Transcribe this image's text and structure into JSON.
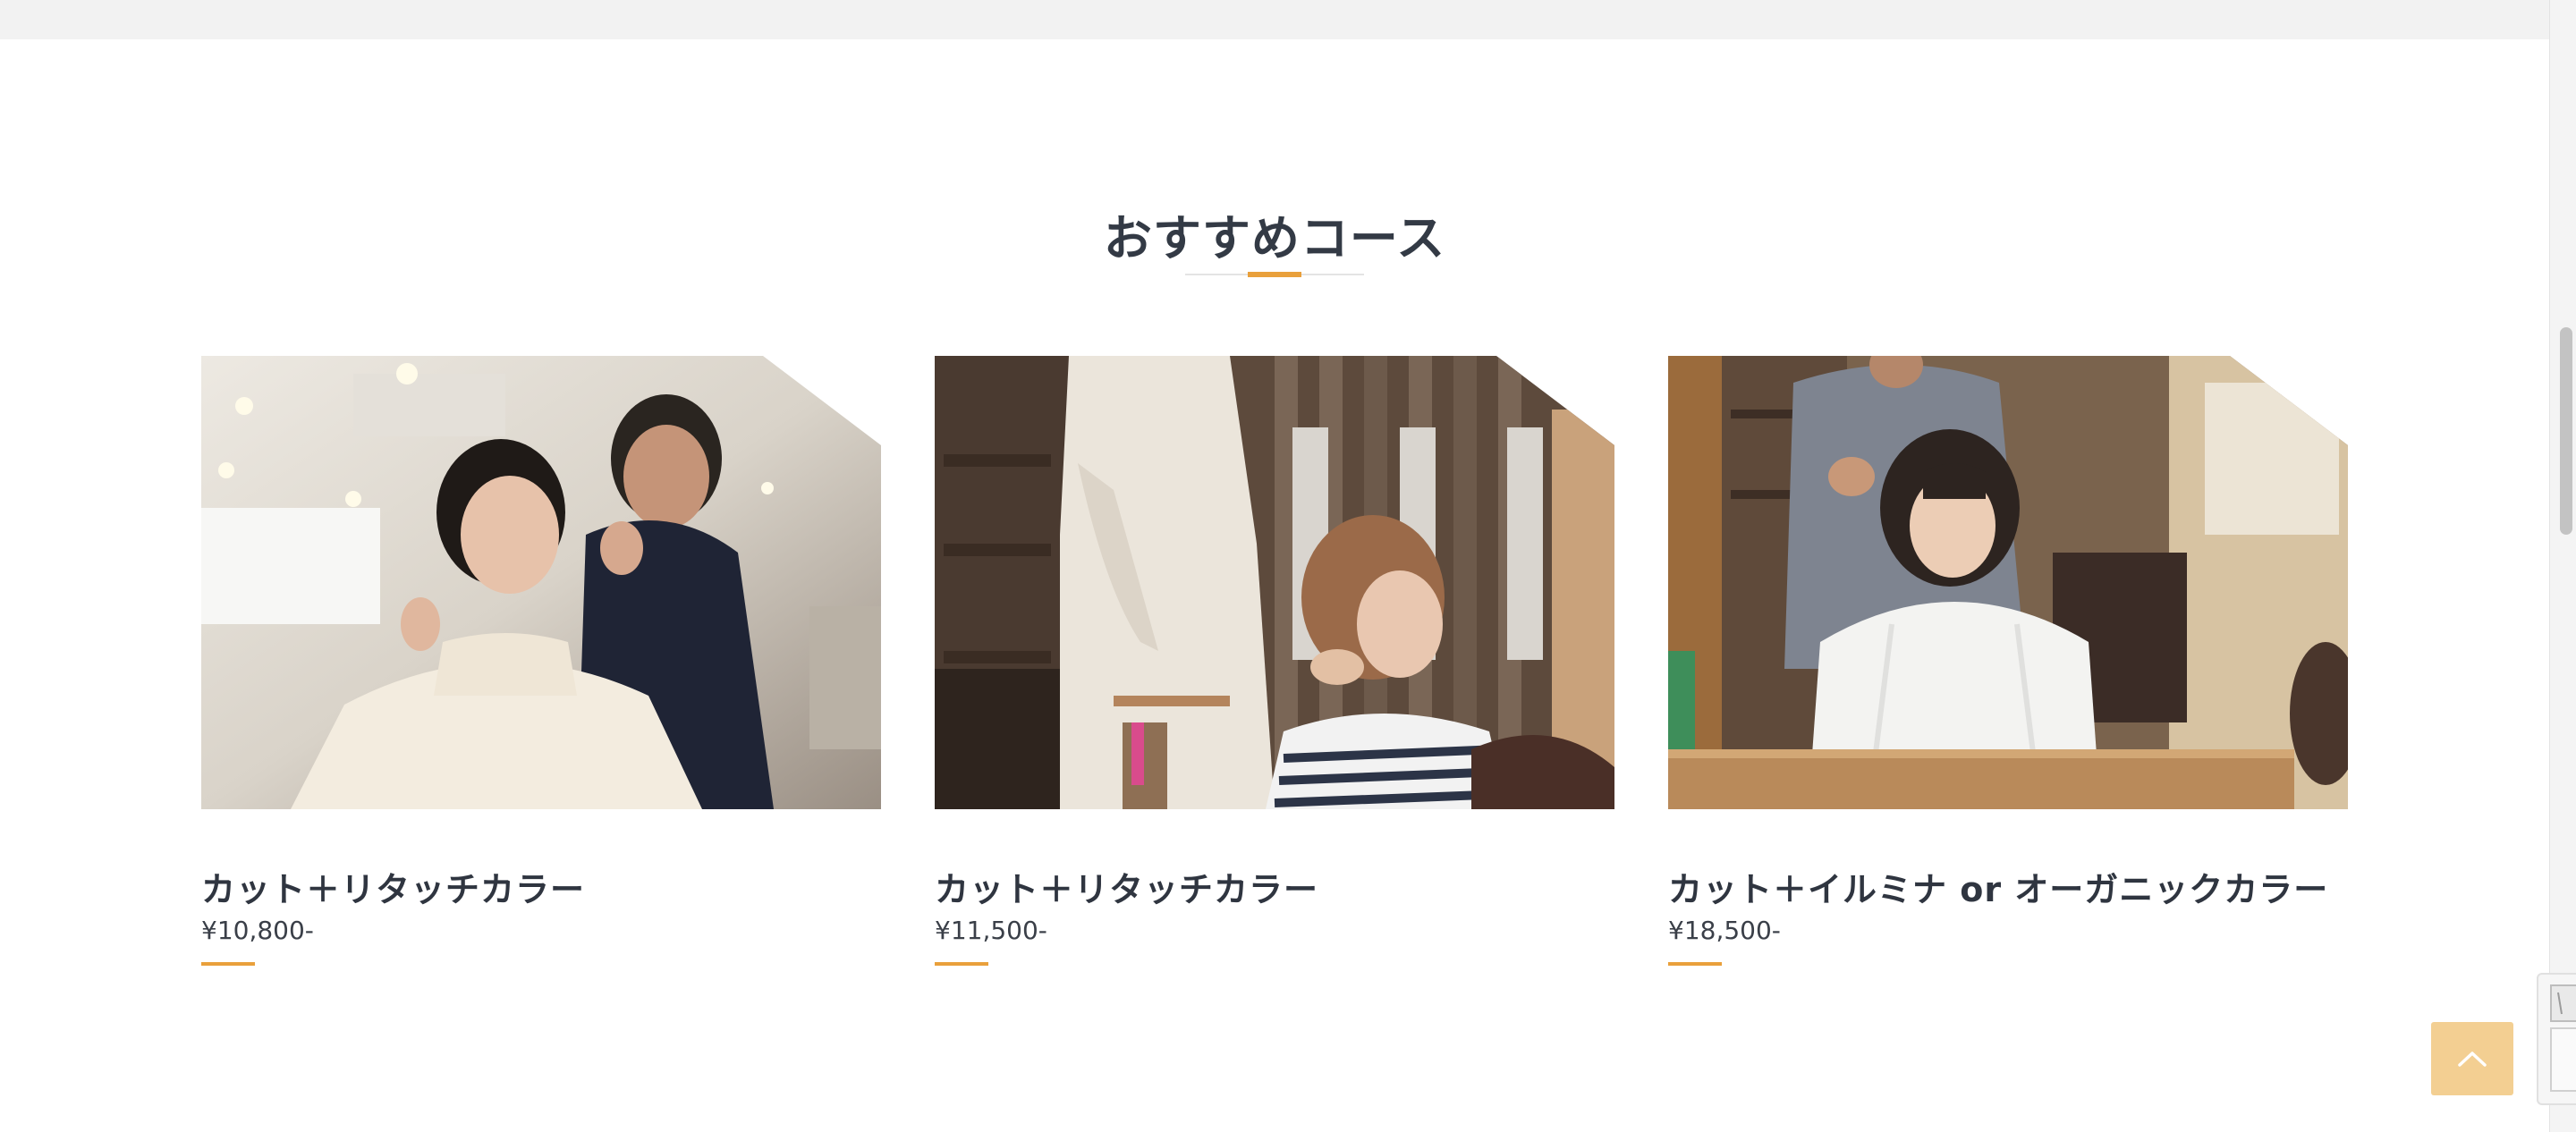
{
  "section": {
    "title": "おすすめコース"
  },
  "courses": [
    {
      "name": "カット＋リタッチカラー",
      "price": "¥10,800-"
    },
    {
      "name": "カット＋リタッチカラー",
      "price": "¥11,500-"
    },
    {
      "name": "カット＋イルミナ or オーガニックカラー",
      "price": "¥18,500-"
    }
  ],
  "colors": {
    "accent": "#e9a03b",
    "title_text": "#333a45",
    "back_to_top_bg": "#f3cf92"
  },
  "icons": {
    "back_to_top": "chevron-up-icon"
  }
}
